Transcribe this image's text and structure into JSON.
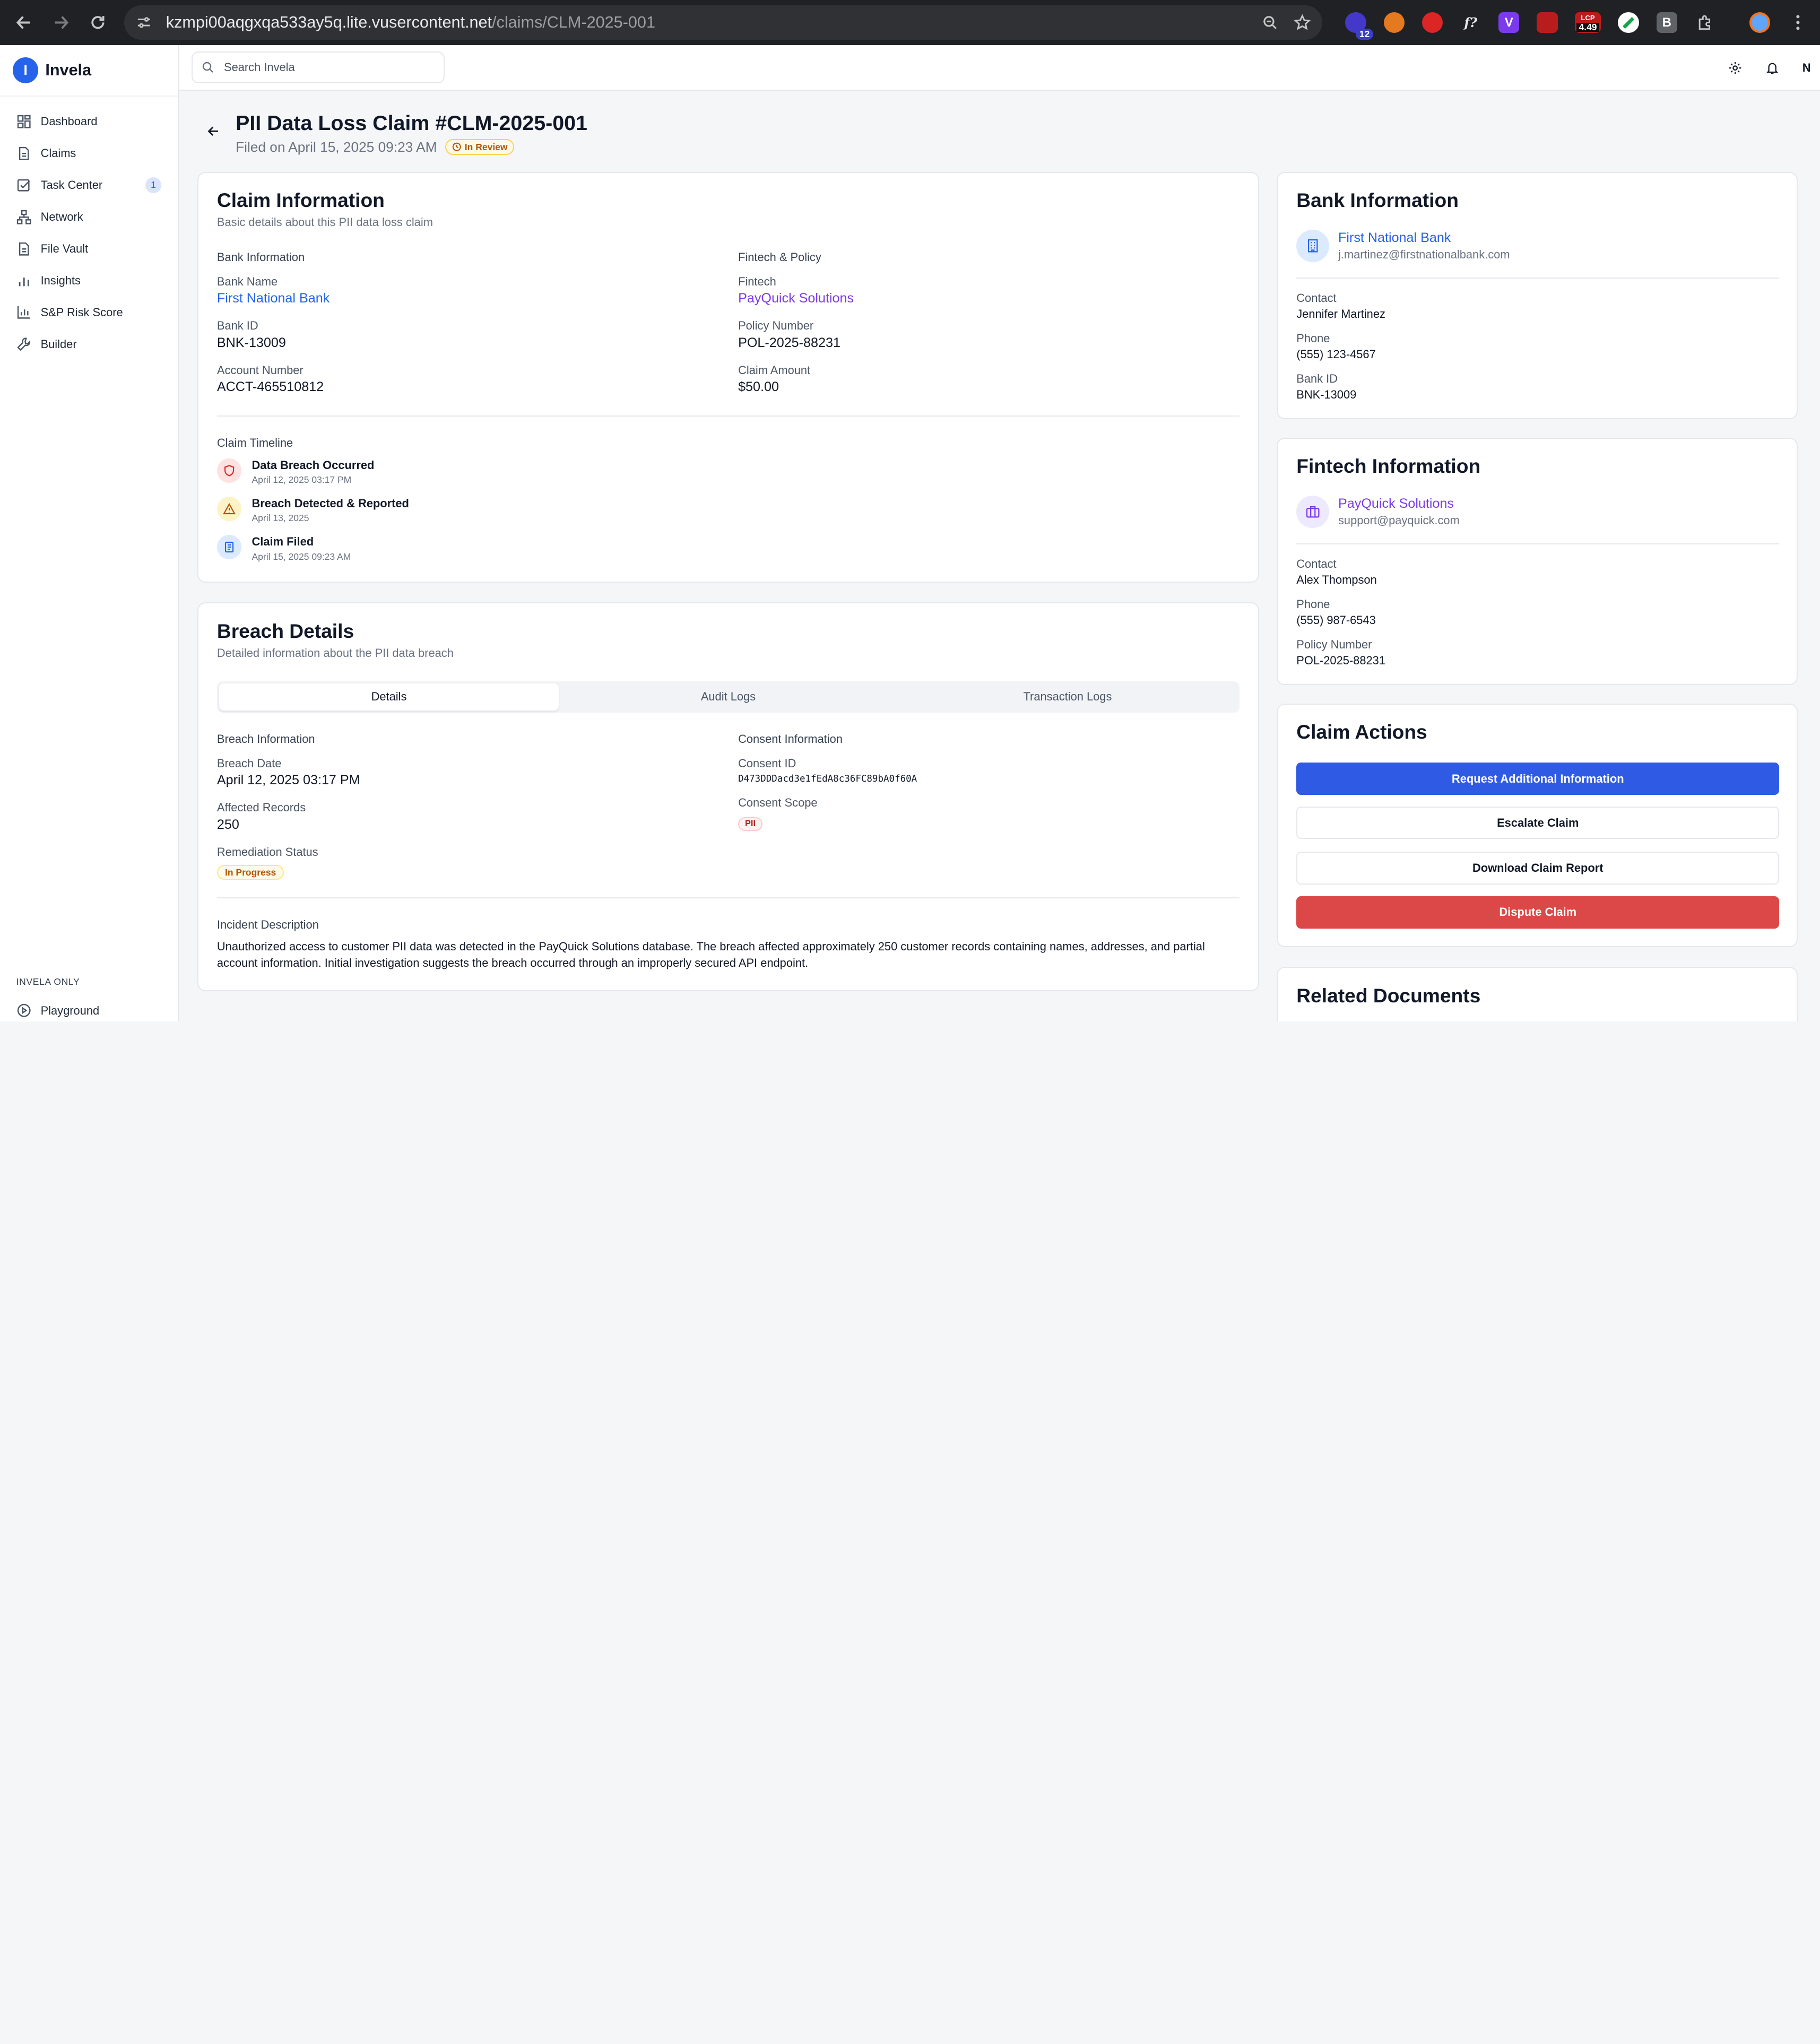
{
  "browser": {
    "url_host": "kzmpi00aqgxqa533ay5q.lite.vusercontent.net",
    "url_path": "/claims/CLM-2025-001",
    "ext_badge_count": "12",
    "ext_lcp_label": "LCP",
    "ext_lcp_value": "4.49"
  },
  "sidebar": {
    "brand_initial": "I",
    "brand_name": "Invela",
    "items": [
      {
        "label": "Dashboard",
        "icon": "dashboard-icon"
      },
      {
        "label": "Claims",
        "icon": "file-icon"
      },
      {
        "label": "Task Center",
        "icon": "checkbox-icon",
        "count": "1"
      },
      {
        "label": "Network",
        "icon": "network-icon"
      },
      {
        "label": "File Vault",
        "icon": "file-icon"
      },
      {
        "label": "Insights",
        "icon": "bar-chart-icon"
      },
      {
        "label": "S&P Risk Score",
        "icon": "chart-icon"
      },
      {
        "label": "Builder",
        "icon": "wrench-icon"
      }
    ],
    "section_label": "INVELA ONLY",
    "playground_label": "Playground"
  },
  "topbar": {
    "search_placeholder": "Search Invela",
    "user_initial": "N"
  },
  "page": {
    "title": "PII Data Loss Claim #CLM-2025-001",
    "filed_on": "Filed on April 15, 2025 09:23 AM",
    "status": "In Review"
  },
  "claim_info": {
    "title": "Claim Information",
    "description": "Basic details about this PII data loss claim",
    "bank_section": "Bank Information",
    "bank_name_label": "Bank Name",
    "bank_name": "First National Bank",
    "bank_id_label": "Bank ID",
    "bank_id": "BNK-13009",
    "account_label": "Account Number",
    "account": "ACCT-465510812",
    "fintech_section": "Fintech & Policy",
    "fintech_label": "Fintech",
    "fintech": "PayQuick Solutions",
    "policy_label": "Policy Number",
    "policy": "POL-2025-88231",
    "amount_label": "Claim Amount",
    "amount": "$50.00",
    "timeline_label": "Claim Timeline",
    "timeline": [
      {
        "title": "Data Breach Occurred",
        "date": "April 12, 2025 03:17 PM"
      },
      {
        "title": "Breach Detected & Reported",
        "date": "April 13, 2025"
      },
      {
        "title": "Claim Filed",
        "date": "April 15, 2025 09:23 AM"
      }
    ]
  },
  "breach": {
    "title": "Breach Details",
    "description": "Detailed information about the PII data breach",
    "tabs": [
      "Details",
      "Audit Logs",
      "Transaction Logs"
    ],
    "info_section": "Breach Information",
    "date_label": "Breach Date",
    "date": "April 12, 2025 03:17 PM",
    "records_label": "Affected Records",
    "records": "250",
    "remediation_label": "Remediation Status",
    "remediation": "In Progress",
    "consent_section": "Consent Information",
    "consent_id_label": "Consent ID",
    "consent_id": "D473DDDacd3e1fEdA8c36FC89bA0f60A",
    "consent_scope_label": "Consent Scope",
    "consent_scope": "PII",
    "incident_label": "Incident Description",
    "incident": "Unauthorized access to customer PII data was detected in the PayQuick Solutions database. The breach affected approximately 250 customer records containing names, addresses, and partial account information. Initial investigation suggests the breach occurred through an improperly secured API endpoint."
  },
  "bank_card": {
    "title": "Bank Information",
    "name": "First National Bank",
    "email": "j.martinez@firstnationalbank.com",
    "contact_label": "Contact",
    "contact": "Jennifer Martinez",
    "phone_label": "Phone",
    "phone": "(555) 123-4567",
    "bank_id_label": "Bank ID",
    "bank_id": "BNK-13009"
  },
  "fintech_card": {
    "title": "Fintech Information",
    "name": "PayQuick Solutions",
    "email": "support@payquick.com",
    "contact_label": "Contact",
    "contact": "Alex Thompson",
    "phone_label": "Phone",
    "phone": "(555) 987-6543",
    "policy_label": "Policy Number",
    "policy": "POL-2025-88231"
  },
  "actions": {
    "title": "Claim Actions",
    "request": "Request Additional Information",
    "escalate": "Escalate Claim",
    "download": "Download Claim Report",
    "dispute": "Dispute Claim"
  },
  "documents": {
    "title": "Related Documents"
  },
  "colors": {
    "primary": "#2f5be4",
    "danger": "#dc4747",
    "link_blue": "#2563eb",
    "link_purple": "#7c3aed",
    "status_amber": "#b45309"
  }
}
